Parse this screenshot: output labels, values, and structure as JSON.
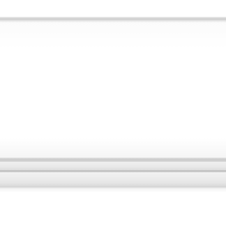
{
  "image": {
    "background_color": "#ffffff",
    "unit_color": "#ffffff",
    "trim_color": "#d4d4d4"
  }
}
